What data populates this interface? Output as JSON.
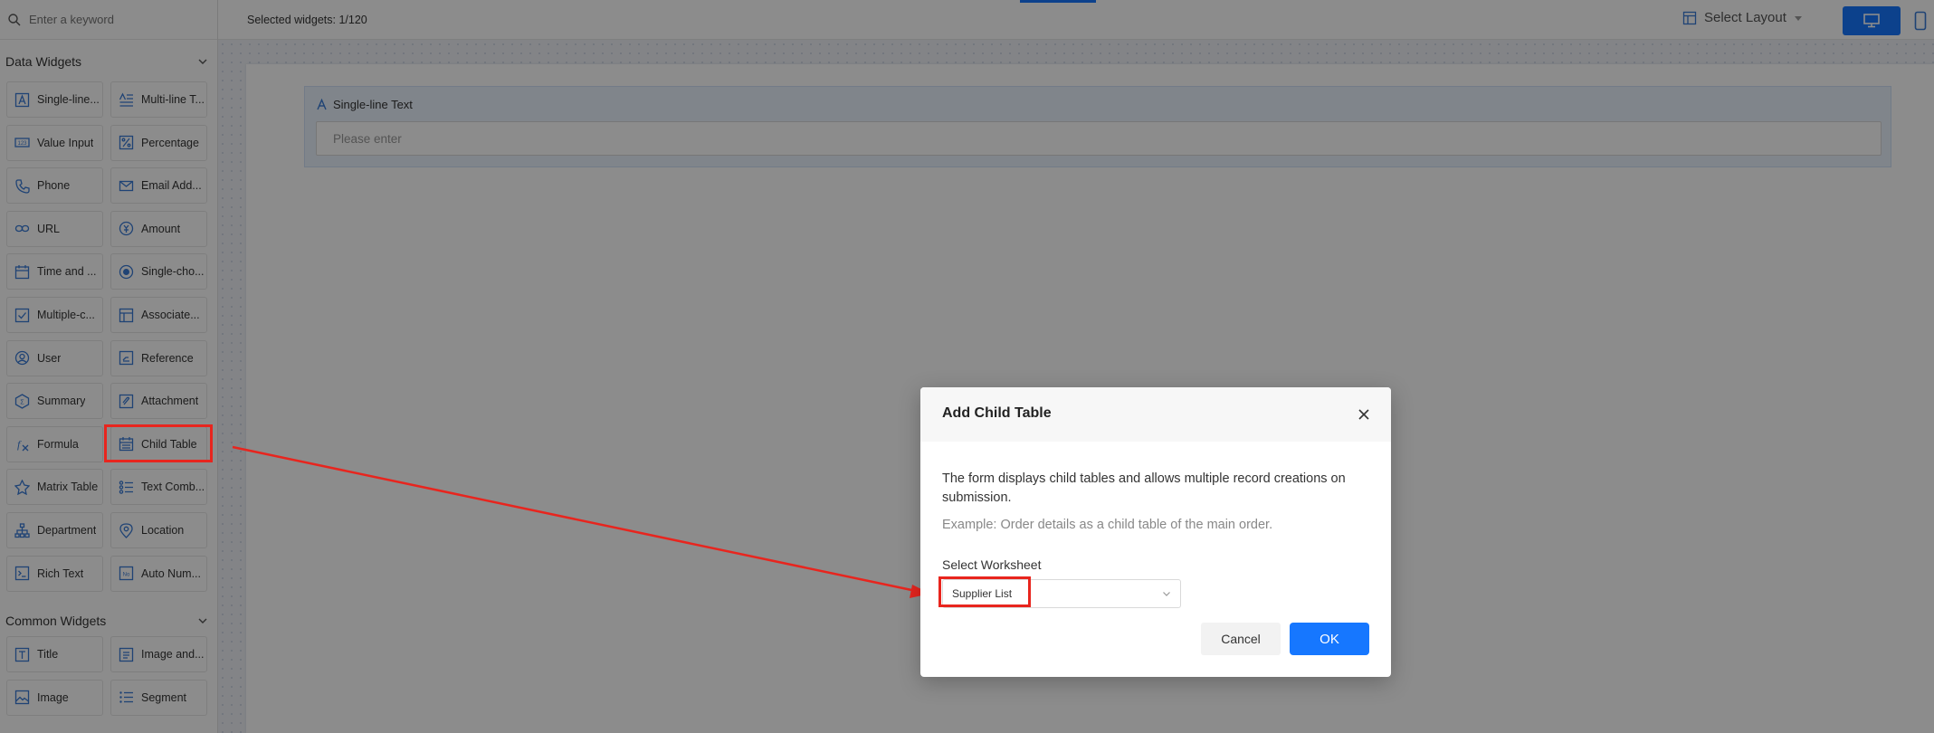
{
  "search": {
    "placeholder": "Enter a keyword"
  },
  "sidebar": {
    "data_widgets_title": "Data Widgets",
    "data_widgets": [
      {
        "label": "Single-line...",
        "icon": "text-icon"
      },
      {
        "label": "Multi-line T...",
        "icon": "multiline-text-icon"
      },
      {
        "label": "Value Input",
        "icon": "number-icon"
      },
      {
        "label": "Percentage",
        "icon": "percent-icon"
      },
      {
        "label": "Phone",
        "icon": "phone-icon"
      },
      {
        "label": "Email Add...",
        "icon": "email-icon"
      },
      {
        "label": "URL",
        "icon": "link-icon"
      },
      {
        "label": "Amount",
        "icon": "currency-icon"
      },
      {
        "label": "Time and ...",
        "icon": "calendar-icon"
      },
      {
        "label": "Single-cho...",
        "icon": "radio-icon"
      },
      {
        "label": "Multiple-c...",
        "icon": "checkbox-icon"
      },
      {
        "label": "Associate...",
        "icon": "association-icon"
      },
      {
        "label": "User",
        "icon": "user-icon"
      },
      {
        "label": "Reference",
        "icon": "reference-icon"
      },
      {
        "label": "Summary",
        "icon": "summary-icon"
      },
      {
        "label": "Attachment",
        "icon": "attachment-icon"
      },
      {
        "label": "Formula",
        "icon": "formula-icon"
      },
      {
        "label": "Child Table",
        "icon": "child-table-icon"
      },
      {
        "label": "Matrix Table",
        "icon": "matrix-icon"
      },
      {
        "label": "Text Comb...",
        "icon": "text-combination-icon"
      },
      {
        "label": "Department",
        "icon": "department-icon"
      },
      {
        "label": "Location",
        "icon": "location-icon"
      },
      {
        "label": "Rich Text",
        "icon": "rich-text-icon"
      },
      {
        "label": "Auto Num...",
        "icon": "auto-number-icon"
      }
    ],
    "common_widgets_title": "Common Widgets",
    "common_widgets": [
      {
        "label": "Title",
        "icon": "title-icon"
      },
      {
        "label": "Image and...",
        "icon": "image-text-icon"
      },
      {
        "label": "Image",
        "icon": "image-icon"
      },
      {
        "label": "Segment",
        "icon": "segment-icon"
      }
    ]
  },
  "topbar": {
    "selected_count": "Selected widgets: 1/120",
    "layout_label": "Select Layout"
  },
  "canvas": {
    "field_label": "Single-line Text",
    "field_placeholder": "Please enter"
  },
  "dialog": {
    "title": "Add Child Table",
    "description": "The form displays child tables and allows multiple record creations on submission.",
    "example": "Example: Order details as a child table of the main order.",
    "select_label": "Select Worksheet",
    "select_value": "Supplier List",
    "cancel_label": "Cancel",
    "ok_label": "OK"
  },
  "colors": {
    "accent": "#1677ff",
    "highlight": "#e8251e",
    "icon": "#3a7bd5"
  }
}
